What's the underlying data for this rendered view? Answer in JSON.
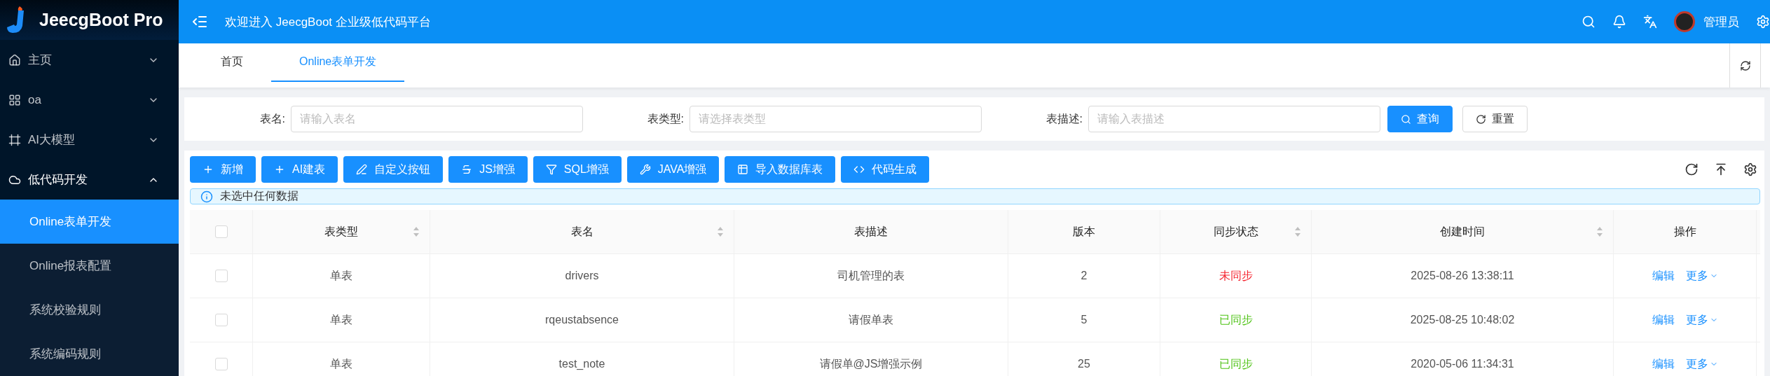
{
  "brand": {
    "name": "JeecgBoot Pro"
  },
  "header": {
    "title": "欢迎进入 JeecgBoot 企业级低代码平台",
    "user": "管理员"
  },
  "sidebar": {
    "items": [
      {
        "label": "主页",
        "expanded": false
      },
      {
        "label": "oa",
        "expanded": false
      },
      {
        "label": "AI大模型",
        "expanded": false
      },
      {
        "label": "低代码开发",
        "expanded": true,
        "children": [
          {
            "label": "Online表单开发",
            "selected": true
          },
          {
            "label": "Online报表配置",
            "selected": false
          },
          {
            "label": "系统校验规则",
            "selected": false
          },
          {
            "label": "系统编码规则",
            "selected": false
          }
        ]
      }
    ]
  },
  "tabs": [
    {
      "label": "首页",
      "selected": false
    },
    {
      "label": "Online表单开发",
      "selected": true
    }
  ],
  "search": {
    "fields": [
      {
        "label": "表名:",
        "placeholder": "请输入表名"
      },
      {
        "label": "表类型:",
        "placeholder": "请选择表类型"
      },
      {
        "label": "表描述:",
        "placeholder": "请输入表描述"
      }
    ],
    "query_button": "查询",
    "reset_button": "重置"
  },
  "toolbar": {
    "buttons": [
      "新增",
      "AI建表",
      "自定义按钮",
      "JS增强",
      "SQL增强",
      "JAVA增强",
      "导入数据库表",
      "代码生成"
    ]
  },
  "alert": "未选中任何数据",
  "table": {
    "all_checked": false,
    "columns": [
      {
        "label": "表类型",
        "sortable": true
      },
      {
        "label": "表名",
        "sortable": true
      },
      {
        "label": "表描述",
        "sortable": false
      },
      {
        "label": "版本",
        "sortable": false
      },
      {
        "label": "同步状态",
        "sortable": true
      },
      {
        "label": "创建时间",
        "sortable": true
      },
      {
        "label": "操作",
        "sortable": false
      }
    ],
    "rows": [
      {
        "checked": false,
        "type": "单表",
        "name": "drivers",
        "description": "司机管理的表",
        "version": "2",
        "sync": {
          "label": "未同步",
          "synced": false
        },
        "created": "2025-08-26 13:38:11",
        "edit": "编辑",
        "more": "更多"
      },
      {
        "checked": false,
        "type": "单表",
        "name": "rqeustabsence",
        "description": "请假单表",
        "version": "5",
        "sync": {
          "label": "已同步",
          "synced": true
        },
        "created": "2025-08-25 10:48:02",
        "edit": "编辑",
        "more": "更多"
      },
      {
        "checked": false,
        "type": "单表",
        "name": "test_note",
        "description": "请假单@JS增强示例",
        "version": "25",
        "sync": {
          "label": "已同步",
          "synced": true
        },
        "created": "2020-05-06 11:34:31",
        "edit": "编辑",
        "more": "更多"
      }
    ]
  }
}
